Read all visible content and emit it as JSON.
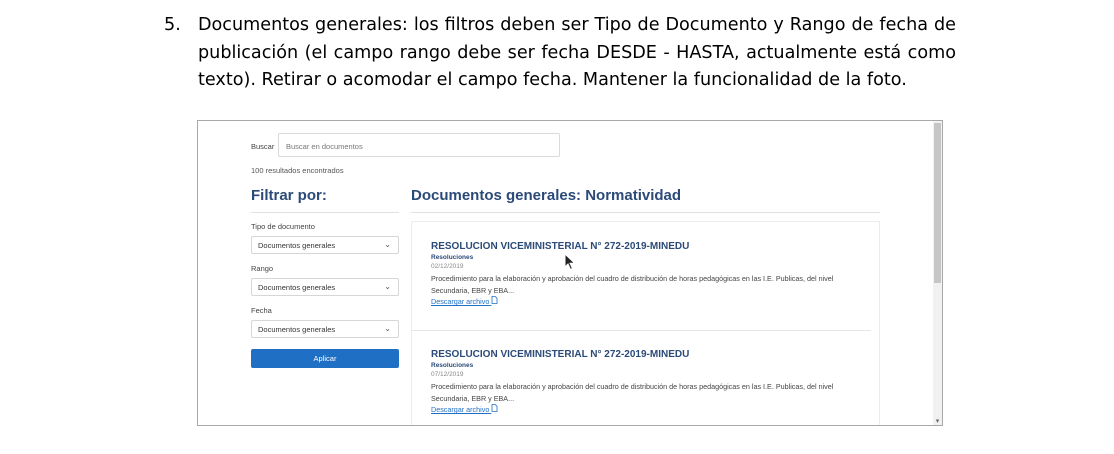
{
  "document_item": {
    "number": "5.",
    "text": "Documentos generales: los filtros deben ser Tipo de Documento y Rango de fecha de publicación (el campo rango debe ser fecha DESDE - HASTA, actualmente está como texto). Retirar o acomodar el campo fecha. Mantener la funcionalidad de la foto."
  },
  "screenshot": {
    "search": {
      "label": "Buscar",
      "placeholder": "Buscar en documentos"
    },
    "results_count": "100 resultados encontrados",
    "filters": {
      "title": "Filtrar por:",
      "tipo": {
        "label": "Tipo de documento",
        "value": "Documentos generales"
      },
      "rango": {
        "label": "Rango",
        "value": "Documentos generales"
      },
      "fecha": {
        "label": "Fecha",
        "value": "Documentos generales"
      },
      "apply_label": "Aplicar"
    },
    "main_title": "Documentos generales: Normatividad",
    "results": [
      {
        "title": "RESOLUCION VICEMINISTERIAL N° 272-2019-MINEDU",
        "category": "Resoluciones",
        "date": "02/12/2019",
        "description": "Procedimiento para la elaboración y aprobación del cuadro de distribución de horas pedagógicas en las I.E. Publicas, del nivel Secundaria, EBR y EBA...",
        "link": "Descargar archivo"
      },
      {
        "title": "RESOLUCION VICEMINISTERIAL N° 272-2019-MINEDU",
        "category": "Resoluciones",
        "date": "07/12/2019",
        "description": "Procedimiento para la elaboración y aprobación del cuadro de distribución de horas pedagógicas en las I.E. Publicas, del nivel Secundaria, EBR y EBA...",
        "link": "Descargar archivo"
      }
    ]
  },
  "icons": {
    "chevron": "chevron-down-icon",
    "file": "file-icon",
    "cursor": "mouse-cursor-icon"
  },
  "colors": {
    "heading": "#2b4a78",
    "button": "#1f6fc5",
    "link": "#1f6fc5"
  }
}
